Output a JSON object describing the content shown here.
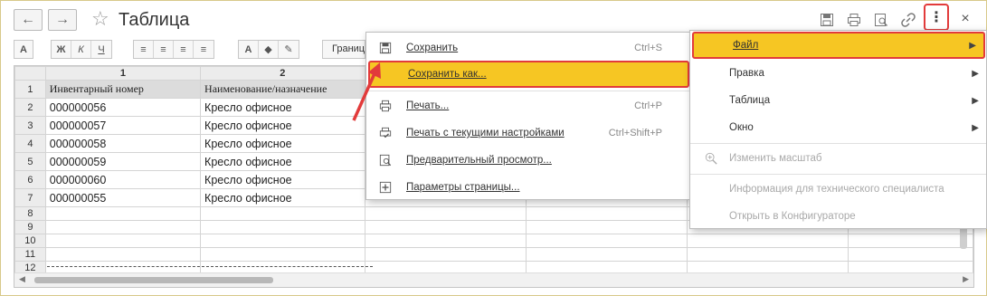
{
  "window": {
    "title": "Таблица",
    "back_icon": "←",
    "forward_icon": "→",
    "star_icon": "☆"
  },
  "toolbar": {
    "font_btn": "A",
    "bold": "Ж",
    "italic": "К",
    "underline": "Ч",
    "text_color_btn": "A",
    "granitsy": "Границ",
    "more_icon": "⋮",
    "close_icon": "×"
  },
  "sheet": {
    "col_headers": [
      "1",
      "2"
    ],
    "rows": [
      {
        "num": "1",
        "c1": "Инвентарный номер",
        "c2": "Наименование/назначение"
      },
      {
        "num": "2",
        "c1": "000000056",
        "c2": "Кресло офисное"
      },
      {
        "num": "3",
        "c1": "000000057",
        "c2": "Кресло офисное"
      },
      {
        "num": "4",
        "c1": "000000058",
        "c2": "Кресло офисное"
      },
      {
        "num": "5",
        "c1": "000000059",
        "c2": "Кресло офисное"
      },
      {
        "num": "6",
        "c1": "000000060",
        "c2": "Кресло офисное"
      },
      {
        "num": "7",
        "c1": "000000055",
        "c2": "Кресло офисное"
      },
      {
        "num": "8",
        "c1": "",
        "c2": ""
      },
      {
        "num": "9",
        "c1": "",
        "c2": ""
      },
      {
        "num": "10",
        "c1": "",
        "c2": ""
      },
      {
        "num": "11",
        "c1": "",
        "c2": ""
      },
      {
        "num": "12",
        "c1": "",
        "c2": ""
      }
    ]
  },
  "file_menu": {
    "items": [
      {
        "label": "Сохранить",
        "shortcut": "Ctrl+S",
        "icon": "save-icon"
      },
      {
        "label": "Сохранить как...",
        "shortcut": "",
        "icon": ""
      },
      {
        "label": "Печать...",
        "shortcut": "Ctrl+P",
        "icon": "print-icon"
      },
      {
        "label": "Печать с текущими настройками",
        "shortcut": "Ctrl+Shift+P",
        "icon": "print-settings-icon"
      },
      {
        "label": "Предварительный просмотр...",
        "shortcut": "",
        "icon": "preview-icon"
      },
      {
        "label": "Параметры страницы...",
        "shortcut": "",
        "icon": "page-setup-icon"
      }
    ]
  },
  "main_menu": {
    "items": [
      {
        "label": "Файл"
      },
      {
        "label": "Правка"
      },
      {
        "label": "Таблица"
      },
      {
        "label": "Окно"
      },
      {
        "label": "Изменить масштаб"
      },
      {
        "label": "Информация для технического специалиста"
      },
      {
        "label": "Открыть в Конфигураторе"
      }
    ]
  },
  "colors": {
    "highlight": "#f6c623",
    "annotation": "#e23b3b"
  }
}
